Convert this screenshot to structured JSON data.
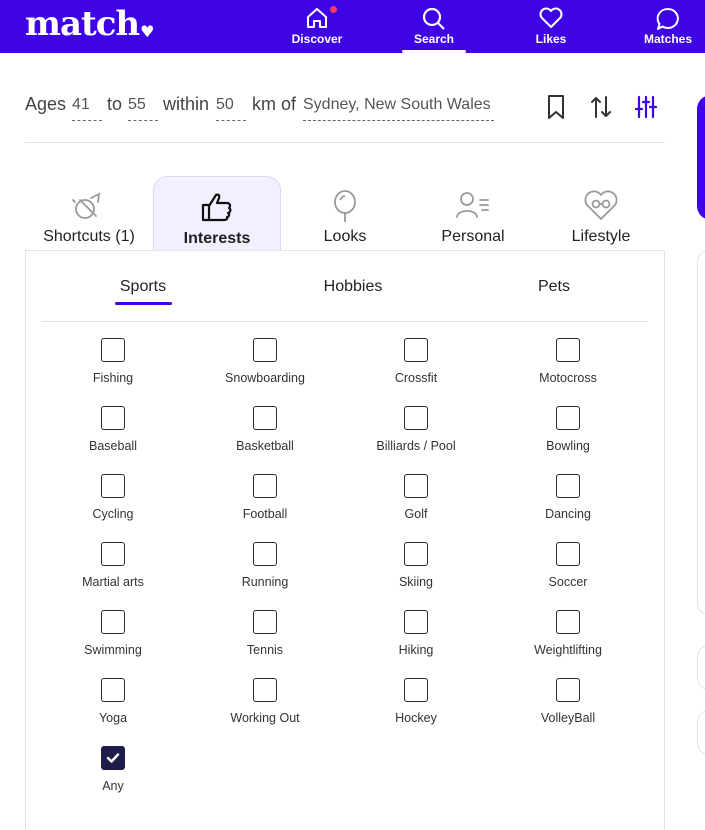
{
  "brand": {
    "logo_text": "match",
    "logo_mark": "♥"
  },
  "nav": {
    "items": [
      {
        "label": "Discover",
        "icon": "home-icon",
        "has_notification": true
      },
      {
        "label": "Search",
        "icon": "search-icon",
        "active": true
      },
      {
        "label": "Likes",
        "icon": "heart-icon"
      },
      {
        "label": "Matches",
        "icon": "chat-bubble-icon"
      }
    ]
  },
  "search_summary": {
    "ages_label": "Ages",
    "age_min": "41",
    "to_label": "to",
    "age_max": "55",
    "within_label": "within",
    "distance": "50",
    "unit_label": "km of",
    "location": "Sydney, New South Wales"
  },
  "categories": [
    {
      "label": "Shortcuts (1)",
      "icon": "shortcut-icon"
    },
    {
      "label": "Interests",
      "icon": "thumbs-up-icon",
      "active": true
    },
    {
      "label": "Looks",
      "icon": "mirror-icon"
    },
    {
      "label": "Personal",
      "icon": "person-list-icon"
    },
    {
      "label": "Lifestyle",
      "icon": "heart-glasses-icon"
    }
  ],
  "subtabs": [
    {
      "label": "Sports",
      "active": true
    },
    {
      "label": "Hobbies"
    },
    {
      "label": "Pets"
    }
  ],
  "sports_options": [
    {
      "label": "Fishing",
      "checked": false
    },
    {
      "label": "Snowboarding",
      "checked": false
    },
    {
      "label": "Crossfit",
      "checked": false
    },
    {
      "label": "Motocross",
      "checked": false
    },
    {
      "label": "Baseball",
      "checked": false
    },
    {
      "label": "Basketball",
      "checked": false
    },
    {
      "label": "Billiards / Pool",
      "checked": false
    },
    {
      "label": "Bowling",
      "checked": false
    },
    {
      "label": "Cycling",
      "checked": false
    },
    {
      "label": "Football",
      "checked": false
    },
    {
      "label": "Golf",
      "checked": false
    },
    {
      "label": "Dancing",
      "checked": false
    },
    {
      "label": "Martial arts",
      "checked": false
    },
    {
      "label": "Running",
      "checked": false
    },
    {
      "label": "Skiing",
      "checked": false
    },
    {
      "label": "Soccer",
      "checked": false
    },
    {
      "label": "Swimming",
      "checked": false
    },
    {
      "label": "Tennis",
      "checked": false
    },
    {
      "label": "Hiking",
      "checked": false
    },
    {
      "label": "Weightlifting",
      "checked": false
    },
    {
      "label": "Yoga",
      "checked": false
    },
    {
      "label": "Working Out",
      "checked": false
    },
    {
      "label": "Hockey",
      "checked": false
    },
    {
      "label": "VolleyBall",
      "checked": false
    },
    {
      "label": "Any",
      "checked": true
    }
  ],
  "colors": {
    "brand_purple": "#3f04e6",
    "checked_fill": "#1e1d4a",
    "active_tab_bg": "#f2effe"
  }
}
